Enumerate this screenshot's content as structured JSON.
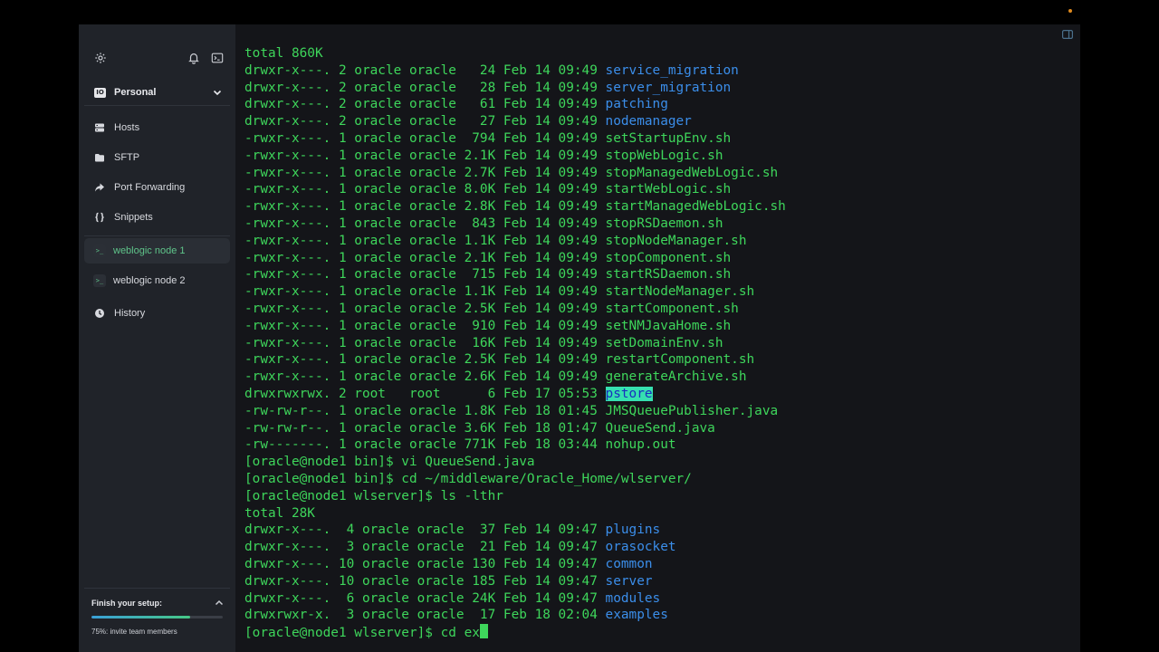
{
  "sidebar": {
    "vault_logo": "IO",
    "vault_name": "Personal",
    "nav": [
      {
        "label": "Hosts",
        "icon": "hosts-icon"
      },
      {
        "label": "SFTP",
        "icon": "folder-icon"
      },
      {
        "label": "Port Forwarding",
        "icon": "port-forward-icon"
      },
      {
        "label": "Snippets",
        "icon": "braces-icon"
      }
    ],
    "sessions": [
      {
        "label": "weblogic node 1",
        "badge": ">_",
        "active": true
      },
      {
        "label": "weblogic node 2",
        "badge": ">_",
        "active": false
      }
    ],
    "history_label": "History",
    "setup": {
      "title": "Finish your setup:",
      "progress": 0.75,
      "caption": "75%: invite team members"
    }
  },
  "colors": {
    "accent_green": "#5fc48a",
    "terminal_green": "#3ed65b",
    "terminal_blue": "#3b8eea",
    "highlight_bg": "#36e0b0"
  },
  "terminal": {
    "lines": [
      {
        "text": "total 860K"
      },
      {
        "text": "drwxr-x---. 2 oracle oracle   24 Feb 14 09:49 ",
        "name": "service_migration",
        "type": "dir"
      },
      {
        "text": "drwxr-x---. 2 oracle oracle   28 Feb 14 09:49 ",
        "name": "server_migration",
        "type": "dir"
      },
      {
        "text": "drwxr-x---. 2 oracle oracle   61 Feb 14 09:49 ",
        "name": "patching",
        "type": "dir"
      },
      {
        "text": "drwxr-x---. 2 oracle oracle   27 Feb 14 09:49 ",
        "name": "nodemanager",
        "type": "dir"
      },
      {
        "text": "-rwxr-x---. 1 oracle oracle  794 Feb 14 09:49 ",
        "name": "setStartupEnv.sh",
        "type": "exe"
      },
      {
        "text": "-rwxr-x---. 1 oracle oracle 2.1K Feb 14 09:49 ",
        "name": "stopWebLogic.sh",
        "type": "exe"
      },
      {
        "text": "-rwxr-x---. 1 oracle oracle 2.7K Feb 14 09:49 ",
        "name": "stopManagedWebLogic.sh",
        "type": "exe"
      },
      {
        "text": "-rwxr-x---. 1 oracle oracle 8.0K Feb 14 09:49 ",
        "name": "startWebLogic.sh",
        "type": "exe"
      },
      {
        "text": "-rwxr-x---. 1 oracle oracle 2.8K Feb 14 09:49 ",
        "name": "startManagedWebLogic.sh",
        "type": "exe"
      },
      {
        "text": "-rwxr-x---. 1 oracle oracle  843 Feb 14 09:49 ",
        "name": "stopRSDaemon.sh",
        "type": "exe"
      },
      {
        "text": "-rwxr-x---. 1 oracle oracle 1.1K Feb 14 09:49 ",
        "name": "stopNodeManager.sh",
        "type": "exe"
      },
      {
        "text": "-rwxr-x---. 1 oracle oracle 2.1K Feb 14 09:49 ",
        "name": "stopComponent.sh",
        "type": "exe"
      },
      {
        "text": "-rwxr-x---. 1 oracle oracle  715 Feb 14 09:49 ",
        "name": "startRSDaemon.sh",
        "type": "exe"
      },
      {
        "text": "-rwxr-x---. 1 oracle oracle 1.1K Feb 14 09:49 ",
        "name": "startNodeManager.sh",
        "type": "exe"
      },
      {
        "text": "-rwxr-x---. 1 oracle oracle 2.5K Feb 14 09:49 ",
        "name": "startComponent.sh",
        "type": "exe"
      },
      {
        "text": "-rwxr-x---. 1 oracle oracle  910 Feb 14 09:49 ",
        "name": "setNMJavaHome.sh",
        "type": "exe"
      },
      {
        "text": "-rwxr-x---. 1 oracle oracle  16K Feb 14 09:49 ",
        "name": "setDomainEnv.sh",
        "type": "exe"
      },
      {
        "text": "-rwxr-x---. 1 oracle oracle 2.5K Feb 14 09:49 ",
        "name": "restartComponent.sh",
        "type": "exe"
      },
      {
        "text": "-rwxr-x---. 1 oracle oracle 2.6K Feb 14 09:49 ",
        "name": "generateArchive.sh",
        "type": "exe"
      },
      {
        "text": "drwxrwxrwx. 2 root   root      6 Feb 17 05:53 ",
        "name": "pstore",
        "type": "hl"
      },
      {
        "text": "-rw-rw-r--. 1 oracle oracle 1.8K Feb 18 01:45 ",
        "name": "JMSQueuePublisher.java",
        "type": "plain"
      },
      {
        "text": "-rw-rw-r--. 1 oracle oracle 3.6K Feb 18 01:47 ",
        "name": "QueueSend.java",
        "type": "plain"
      },
      {
        "text": "-rw-------. 1 oracle oracle 771K Feb 18 03:44 ",
        "name": "nohup.out",
        "type": "plain"
      },
      {
        "text": "[oracle@node1 bin]$ vi QueueSend.java"
      },
      {
        "text": "[oracle@node1 bin]$ cd ~/middleware/Oracle_Home/wlserver/"
      },
      {
        "text": "[oracle@node1 wlserver]$ ls -lthr"
      },
      {
        "text": "total 28K"
      },
      {
        "text": "drwxr-x---.  4 oracle oracle  37 Feb 14 09:47 ",
        "name": "plugins",
        "type": "dir"
      },
      {
        "text": "drwxr-x---.  3 oracle oracle  21 Feb 14 09:47 ",
        "name": "orasocket",
        "type": "dir"
      },
      {
        "text": "drwxr-x---. 10 oracle oracle 130 Feb 14 09:47 ",
        "name": "common",
        "type": "dir"
      },
      {
        "text": "drwxr-x---. 10 oracle oracle 185 Feb 14 09:47 ",
        "name": "server",
        "type": "dir"
      },
      {
        "text": "drwxr-x---.  6 oracle oracle 24K Feb 14 09:47 ",
        "name": "modules",
        "type": "dir"
      },
      {
        "text": "drwxrwxr-x.  3 oracle oracle  17 Feb 18 02:04 ",
        "name": "examples",
        "type": "dir"
      }
    ],
    "prompt_line": "[oracle@node1 wlserver]$ cd ex"
  }
}
